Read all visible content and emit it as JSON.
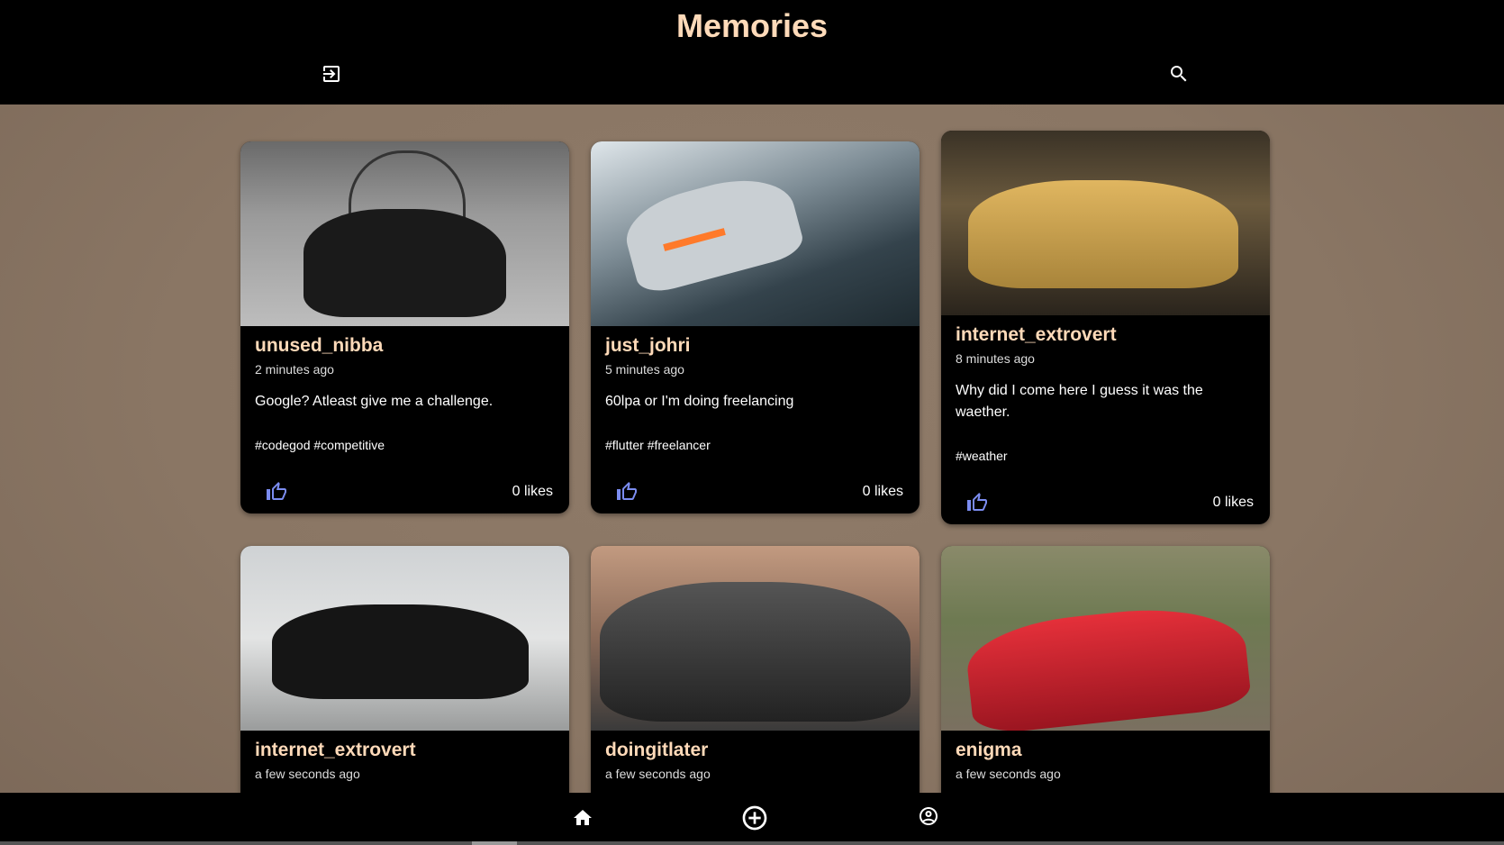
{
  "header": {
    "title": "Memories",
    "left_icon": "logout-icon",
    "right_icon": "search-icon"
  },
  "posts": [
    {
      "user": "unused_nibba",
      "time": "2 minutes ago",
      "caption": "Google? Atleast give me a challenge.",
      "tags": "#codegod #competitive",
      "likes": "0 likes"
    },
    {
      "user": "just_johri",
      "time": "5 minutes ago",
      "caption": "60lpa or I'm doing freelancing",
      "tags": "#flutter #freelancer",
      "likes": "0 likes"
    },
    {
      "user": "internet_extrovert",
      "time": "8 minutes ago",
      "caption": "Why did I come here I guess it was the waether.",
      "tags": "#weather",
      "likes": "0 likes"
    },
    {
      "user": "internet_extrovert",
      "time": "a few seconds ago"
    },
    {
      "user": "doingitlater",
      "time": "a few seconds ago"
    },
    {
      "user": "enigma",
      "time": "a few seconds ago"
    }
  ],
  "nav": {
    "items": [
      "home-icon",
      "add-circle-icon",
      "account-circle-icon"
    ]
  },
  "colors": {
    "accent": "#ffdab9",
    "like": "#7b8cf0",
    "background": "#8a7664"
  }
}
